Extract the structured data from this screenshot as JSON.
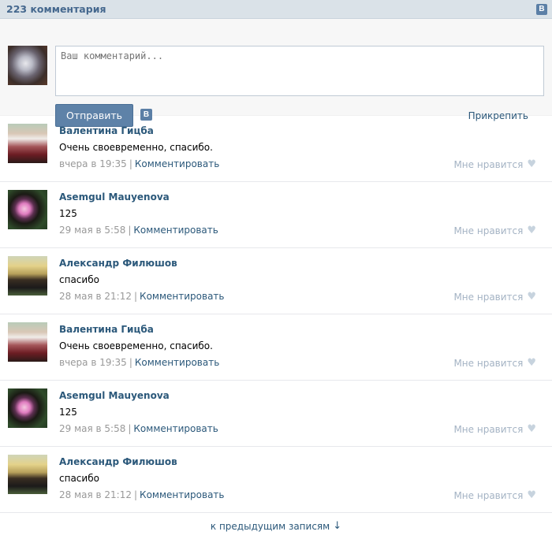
{
  "header": {
    "count_label": "223 комментария",
    "logo": "В"
  },
  "compose": {
    "placeholder": "Ваш комментарий...",
    "send_label": "Отправить",
    "share_logo": "В",
    "attach_label": "Прикрепить"
  },
  "comments": [
    {
      "author": "Валентина Гицба",
      "text": "Очень своевременно, спасибо.",
      "time": "вчера в 19:35",
      "reply_label": "Комментировать",
      "like_label": "Мне нравится",
      "avatar": "rabbit"
    },
    {
      "author": "Asemgul Mauyenova",
      "text": "125",
      "time": "29 мая в 5:58",
      "reply_label": "Комментировать",
      "like_label": "Мне нравится",
      "avatar": "girl"
    },
    {
      "author": "Александр Филюшов",
      "text": "спасибо",
      "time": "28 мая в 21:12",
      "reply_label": "Комментировать",
      "like_label": "Мне нравится",
      "avatar": "man"
    },
    {
      "author": "Валентина Гицба",
      "text": "Очень своевременно, спасибо.",
      "time": "вчера в 19:35",
      "reply_label": "Комментировать",
      "like_label": "Мне нравится",
      "avatar": "rabbit"
    },
    {
      "author": "Asemgul Mauyenova",
      "text": "125",
      "time": "29 мая в 5:58",
      "reply_label": "Комментировать",
      "like_label": "Мне нравится",
      "avatar": "girl"
    },
    {
      "author": "Александр Филюшов",
      "text": "спасибо",
      "time": "28 мая в 21:12",
      "reply_label": "Комментировать",
      "like_label": "Мне нравится",
      "avatar": "man"
    }
  ],
  "more_label": "к предыдущим записям",
  "more_arrow": "↓",
  "meta_separator": "|",
  "heart_glyph": "♥"
}
